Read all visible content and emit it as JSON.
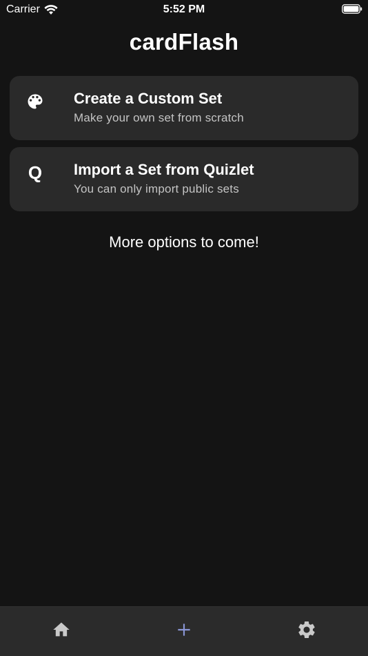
{
  "status_bar": {
    "carrier": "Carrier",
    "time": "5:52 PM"
  },
  "app": {
    "title": "cardFlash"
  },
  "options": [
    {
      "icon": "palette-icon",
      "title": "Create a Custom Set",
      "subtitle": "Make your own set from scratch"
    },
    {
      "icon": "quizlet-q-icon",
      "icon_text": "Q",
      "title": "Import a Set from Quizlet",
      "subtitle": "You can only import public sets"
    }
  ],
  "more_options_text": "More options to come!",
  "tab_bar": {
    "tabs": [
      {
        "icon": "home-icon",
        "active": false
      },
      {
        "icon": "plus-icon",
        "active": true
      },
      {
        "icon": "gear-icon",
        "active": false
      }
    ],
    "active_color": "#8a96d6",
    "inactive_color": "#c9c9c9"
  },
  "colors": {
    "background": "#141414",
    "card": "#2a2a2a",
    "tab_bar": "#2b2b2b",
    "subtitle": "#c4c4c4"
  }
}
